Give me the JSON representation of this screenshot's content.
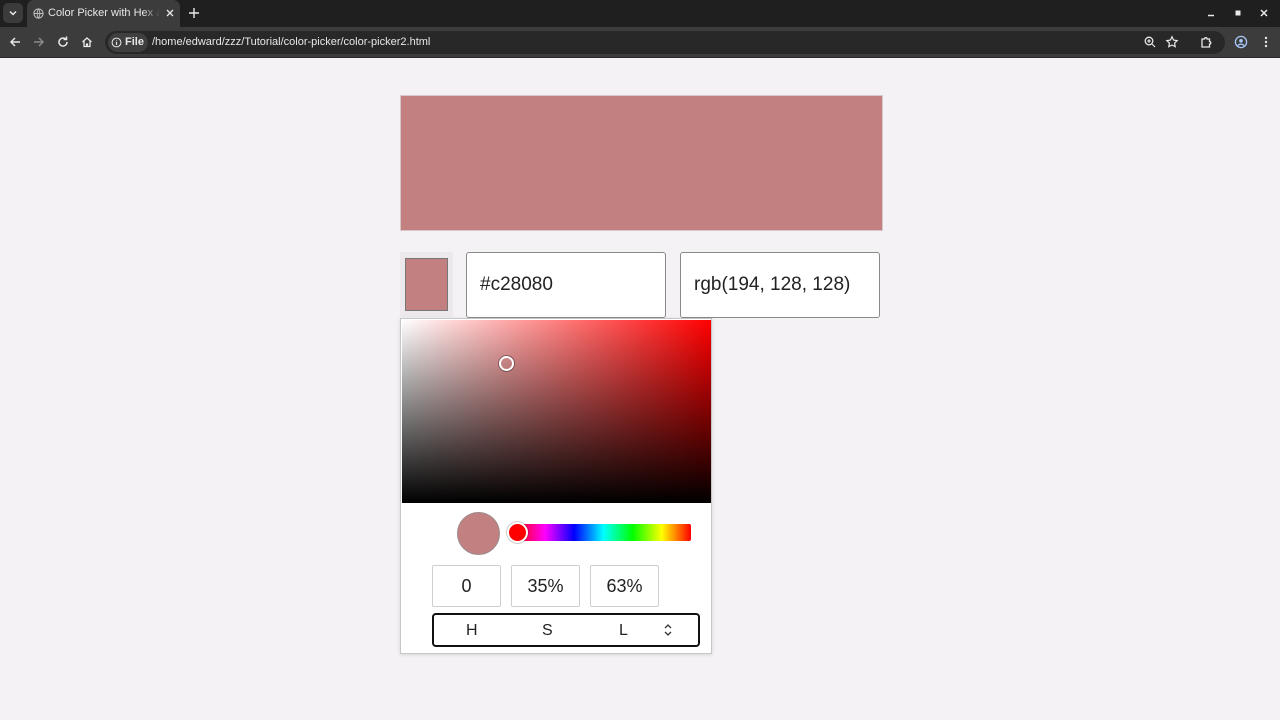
{
  "browser": {
    "tab": {
      "title": "Color Picker with Hex & RGB"
    },
    "address": {
      "scheme_chip": "File",
      "url": "/home/edward/zzz/Tutorial/color-picker/color-picker2.html"
    }
  },
  "colors": {
    "selected": "#c28080",
    "pure_hue": "#ff0000"
  },
  "fields": {
    "hex_value": "#c28080",
    "rgb_value": "rgb(194, 128, 128)"
  },
  "picker": {
    "hue": "0",
    "saturation": "35%",
    "lightness": "63%",
    "hue_position": 0,
    "mode_labels": {
      "h": "H",
      "s": "S",
      "l": "L"
    }
  }
}
